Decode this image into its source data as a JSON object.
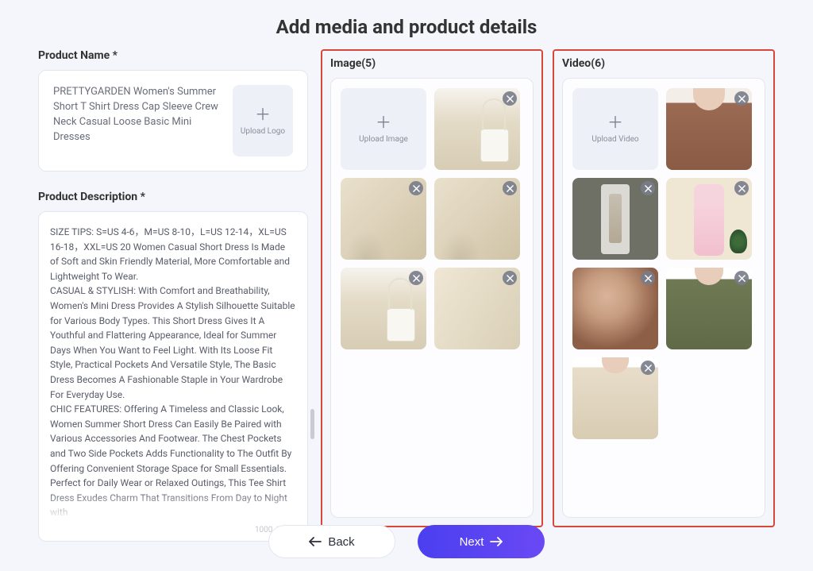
{
  "page": {
    "title": "Add media and product details"
  },
  "productName": {
    "label": "Product Name *",
    "value": " PRETTYGARDEN Women's Summer Short T Shirt Dress Cap Sleeve Crew Neck Casual Loose Basic Mini Dresses",
    "uploadLogoLabel": "Upload Logo"
  },
  "productDescription": {
    "label": "Product Description *",
    "value": "SIZE TIPS: S=US 4-6，M=US 8-10，L=US 12-14，XL=US 16-18，XXL=US 20 Women Casual Short Dress Is Made of Soft and Skin Friendly Material, More Comfortable and Lightweight To Wear.\nCASUAL & STYLISH: With Comfort and Breathability, Women's Mini Dress Provides A Stylish Silhouette Suitable for Various Body Types. This Short Dress Gives It A Youthful and Flattering Appearance, Ideal for Summer Days When You Want to Feel Light. With Its Loose Fit Style, Practical Pockets And Versatile Style, The Basic Dress Becomes A Fashionable Staple in Your Wardrobe For Everyday Use.\nCHIC FEATURES: Offering A Timeless and Classic Look, Women Summer Short Dress Can Easily Be Paired with Various Accessories And Footwear. The Chest Pockets and Two Side Pockets Adds Functionality to The Outfit By Offering Convenient Storage Space for Small Essentials. Perfect for Daily Wear or Relaxed Outings, This Tee Shirt Dress Exudes Charm That Transitions From Day to Night with",
    "charCount": "1000 / 1000"
  },
  "imagePanel": {
    "title": "Image(5)",
    "uploadLabel": "Upload Image",
    "thumbs": [
      {
        "name": "beige-dress-with-handbag"
      },
      {
        "name": "beige-dress-torso-1"
      },
      {
        "name": "beige-dress-torso-2"
      },
      {
        "name": "beige-dress-handbag-close"
      },
      {
        "name": "beige-dress-fabric-close"
      }
    ]
  },
  "videoPanel": {
    "title": "Video(6)",
    "uploadLabel": "Upload Video",
    "thumbs": [
      {
        "name": "model-brown-dress-front"
      },
      {
        "name": "mirror-tryon-scene"
      },
      {
        "name": "model-pink-dress-room"
      },
      {
        "name": "brown-dress-closeup"
      },
      {
        "name": "model-olive-dress"
      },
      {
        "name": "model-beige-dress-studio"
      }
    ]
  },
  "footer": {
    "back": "Back",
    "next": "Next"
  }
}
